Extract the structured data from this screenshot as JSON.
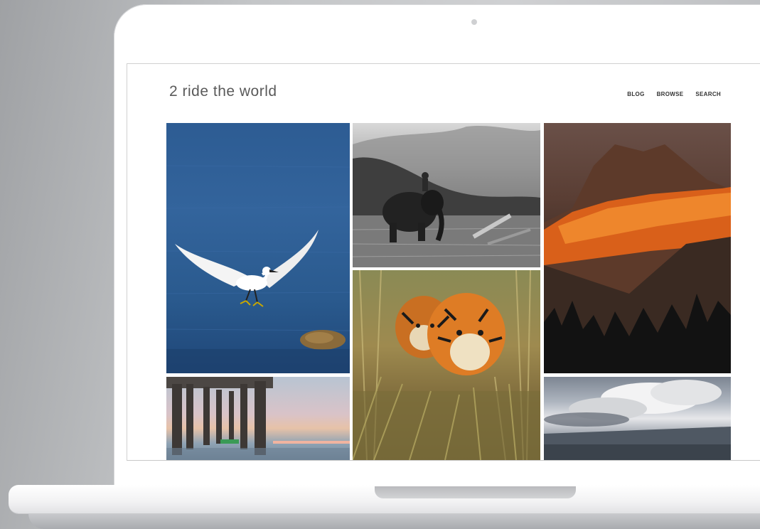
{
  "site": {
    "title": "2 ride the world",
    "nav": [
      "BLOG",
      "BROWSE",
      "SEARCH"
    ]
  },
  "colors": {
    "title": "#5a5a5a",
    "nav": "#333333",
    "sea_blue": "#2d5c93",
    "sunset_orange": "#e0661a"
  }
}
